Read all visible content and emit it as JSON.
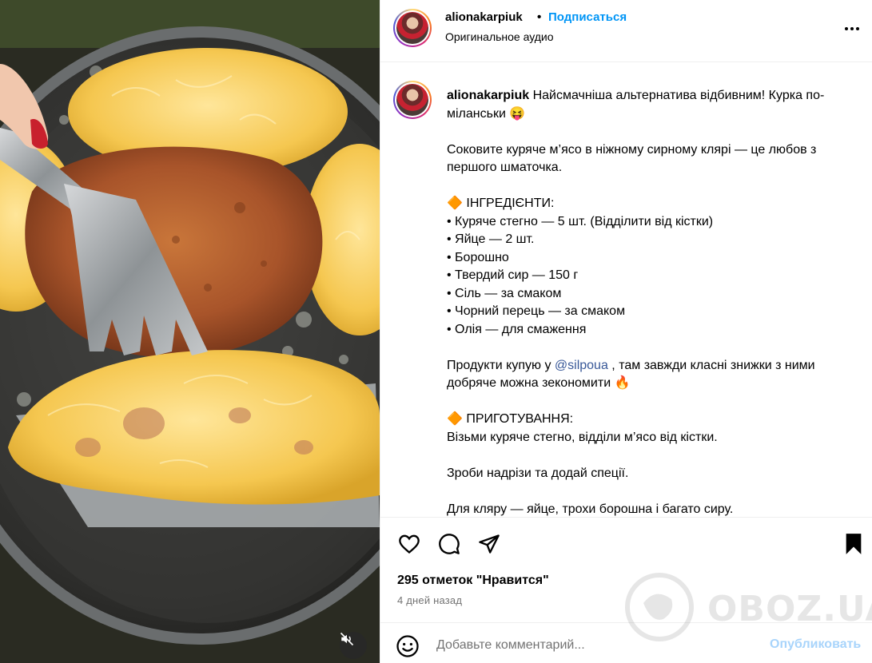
{
  "header": {
    "username": "alionakarpiuk",
    "separator": "•",
    "follow_label": "Подписаться",
    "audio_label": "Оригинальное аудио"
  },
  "caption": {
    "username": "alionakarpiuk",
    "line1": " Найсмачніша альтернатива відбивним! Курка по-міланськи 😝",
    "para2": "Соковите куряче м’ясо в ніжному сирному клярі — це любов з першого шматочка.",
    "ingredients_heading": "🔶 ІНГРЕДІЄНТИ:",
    "ingredients": [
      "• Куряче стегно — 5 шт. (Відділити від кістки)",
      "• Яйце — 2 шт.",
      "• Борошно",
      "• Твердий сир — 150 г",
      "• Сіль — за смаком",
      "• Чорний перець — за смаком",
      "• Олія — для смаження"
    ],
    "shop_before": "Продукти купую у ",
    "shop_mention": "@silpoua",
    "shop_after": " , там завжди класні знижки з ними добряче можна зекономити 🔥",
    "steps_heading": "🔶 ПРИГОТУВАННЯ:",
    "step1": "Візьми куряче стегно, відділи м’ясо від кістки.",
    "step2": "Зроби надрізи та додай спеції.",
    "step3": "Для кляру — яйце, трохи борошна і багато сиру."
  },
  "actions": {
    "likes_label": "295 отметок \"Нравится\"",
    "date_label": "4 дней назад"
  },
  "comment": {
    "placeholder": "Добавьте комментарий...",
    "publish_label": "Опубликовать"
  },
  "watermark": {
    "text": "OBOZ.UA"
  },
  "icons": {
    "like": "heart-icon",
    "comment": "comment-icon",
    "share": "paper-plane-icon",
    "save": "bookmark-icon",
    "more": "more-dots-icon",
    "emoji": "smiley-icon",
    "mute": "speaker-muted-icon"
  },
  "colors": {
    "accent": "#0095f6",
    "publish_disabled": "#a8d4fb",
    "mention": "#385898",
    "muted_text": "#737373"
  }
}
